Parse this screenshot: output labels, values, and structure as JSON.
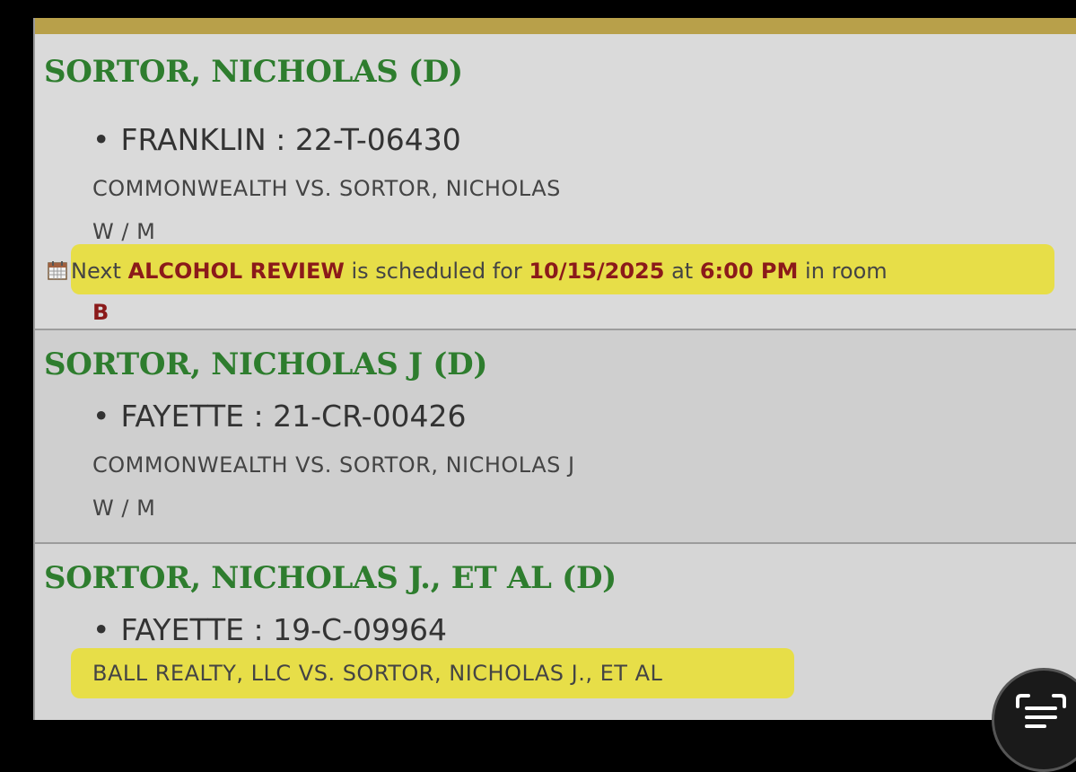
{
  "records": [
    {
      "name": "SORTOR, NICHOLAS (D)",
      "case": "FRANKLIN : 22-T-06430",
      "title": "COMMONWEALTH VS. SORTOR, NICHOLAS",
      "demographics": "W / M",
      "schedule": {
        "prefix": "Next",
        "event": "ALCOHOL REVIEW",
        "mid": "is scheduled for",
        "date": "10/15/2025",
        "at": "at",
        "time": "6:00 PM",
        "room_text": "in room",
        "room": "B"
      }
    },
    {
      "name": "SORTOR, NICHOLAS J (D)",
      "case": "FAYETTE : 21-CR-00426",
      "title": "COMMONWEALTH VS. SORTOR, NICHOLAS J",
      "demographics": "W / M"
    },
    {
      "name": "SORTOR, NICHOLAS J., ET AL (D)",
      "case": "FAYETTE : 19-C-09964",
      "title": "BALL REALTY, LLC VS. SORTOR, NICHOLAS J., ET AL"
    }
  ],
  "bullet": "•",
  "icons": [
    "calendar-icon",
    "text-scan-icon"
  ],
  "colors": {
    "name_green": "#2e7d2e",
    "event_red": "#8b1a1a",
    "highlight": "#e8de3c",
    "gold_bar": "#b8a04a"
  }
}
